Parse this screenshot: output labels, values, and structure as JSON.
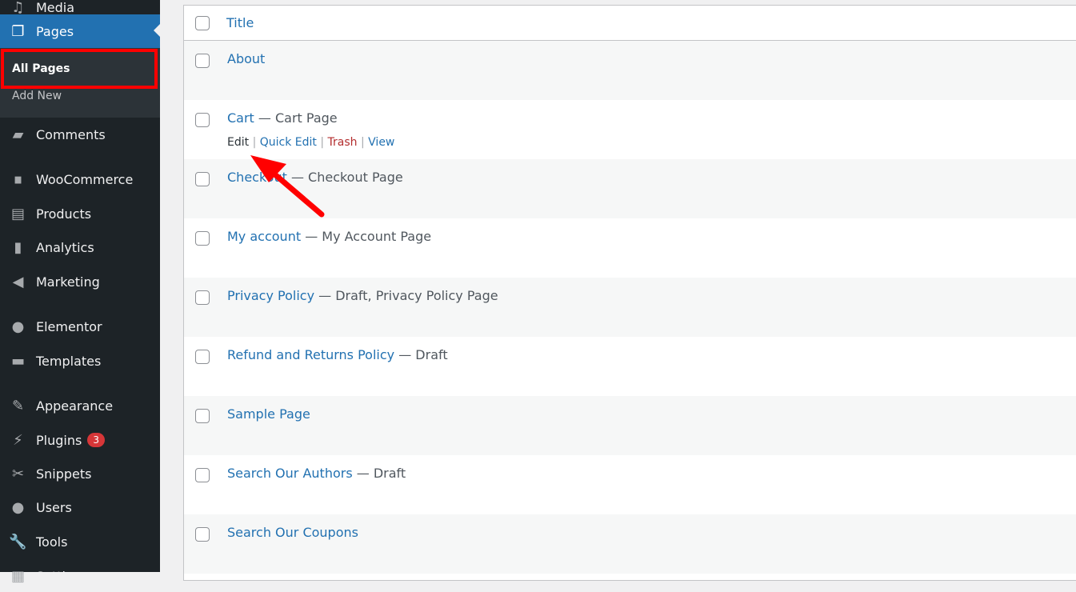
{
  "sidebar": {
    "items": [
      {
        "label": "Media",
        "icon": "media-icon"
      },
      {
        "label": "Pages",
        "icon": "pages-icon",
        "current": true
      },
      {
        "label": "Comments",
        "icon": "comments-icon"
      },
      {
        "label": "WooCommerce",
        "icon": "woocommerce-icon"
      },
      {
        "label": "Products",
        "icon": "products-icon"
      },
      {
        "label": "Analytics",
        "icon": "analytics-icon"
      },
      {
        "label": "Marketing",
        "icon": "megaphone-icon"
      },
      {
        "label": "Elementor",
        "icon": "elementor-icon"
      },
      {
        "label": "Templates",
        "icon": "folder-icon"
      },
      {
        "label": "Appearance",
        "icon": "paintbrush-icon"
      },
      {
        "label": "Plugins",
        "icon": "plugin-icon",
        "badge": "3"
      },
      {
        "label": "Snippets",
        "icon": "scissors-icon"
      },
      {
        "label": "Users",
        "icon": "user-icon"
      },
      {
        "label": "Tools",
        "icon": "wrench-icon"
      },
      {
        "label": "Settings",
        "icon": "settings-icon"
      }
    ],
    "submenu": [
      {
        "label": "All Pages",
        "current": true
      },
      {
        "label": "Add New"
      }
    ]
  },
  "table": {
    "header": "Title",
    "rows": [
      {
        "title": "About",
        "state": ""
      },
      {
        "title": "Cart",
        "state": " — Cart Page",
        "actions": {
          "edit": "Edit",
          "quick_edit": "Quick Edit",
          "trash": "Trash",
          "view": "View"
        }
      },
      {
        "title": "Checkout",
        "state": " — Checkout Page"
      },
      {
        "title": "My account",
        "state": " — My Account Page"
      },
      {
        "title": "Privacy Policy",
        "state": " — Draft, Privacy Policy Page"
      },
      {
        "title": "Refund and Returns Policy",
        "state": " — Draft"
      },
      {
        "title": "Sample Page",
        "state": ""
      },
      {
        "title": "Search Our Authors",
        "state": " — Draft"
      },
      {
        "title": "Search Our Coupons",
        "state": ""
      }
    ]
  },
  "colors": {
    "accent": "#2271b1",
    "sidebar": "#1d2327",
    "highlight": "#ff0000"
  }
}
